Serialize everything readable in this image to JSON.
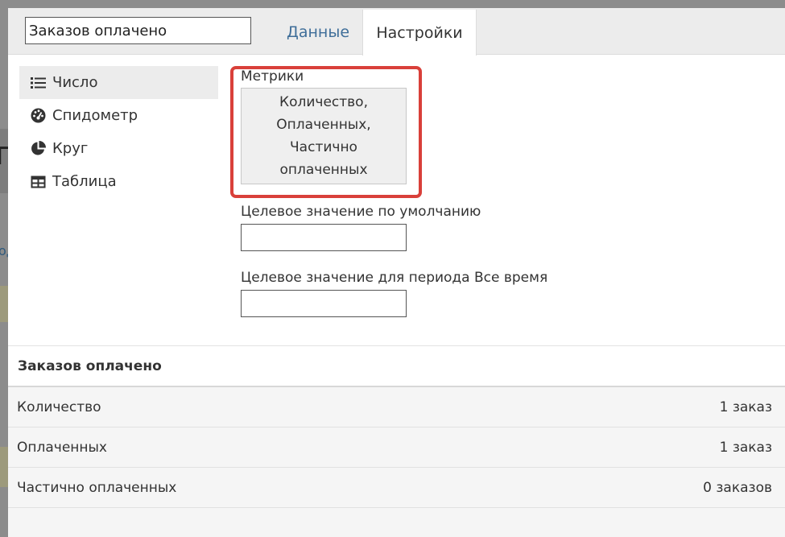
{
  "header": {
    "title_value": "Заказов оплачено",
    "tabs": [
      {
        "label": "Данные"
      },
      {
        "label": "Настройки"
      }
    ]
  },
  "sidebar": {
    "items": [
      {
        "label": "Число",
        "icon": "list-icon"
      },
      {
        "label": "Спидометр",
        "icon": "dashboard-icon"
      },
      {
        "label": "Круг",
        "icon": "pie-chart-icon"
      },
      {
        "label": "Таблица",
        "icon": "table-icon"
      }
    ]
  },
  "settings": {
    "metrics_label": "Метрики",
    "metrics_lines": [
      "Количество,",
      "Оплаченных,",
      "Частично",
      "оплаченных"
    ],
    "default_target_label": "Целевое значение по умолчанию",
    "default_target_value": "",
    "period_target_label": "Целевое значение для периода Все время",
    "period_target_value": ""
  },
  "preview": {
    "title": "Заказов оплачено",
    "rows": [
      {
        "label": "Количество",
        "value": "1 заказ"
      },
      {
        "label": "Оплаченных",
        "value": "1 заказ"
      },
      {
        "label": "Частично оплаченных",
        "value": "0 заказов"
      }
    ]
  },
  "background": {
    "left_text": "г",
    "left_link": "од"
  },
  "colors": {
    "highlight": "#d9403a",
    "tab_link": "#3f6e99",
    "active_item_bg": "#ececec"
  }
}
